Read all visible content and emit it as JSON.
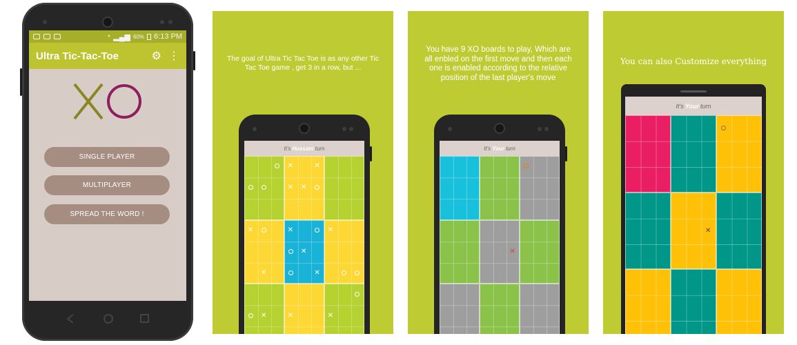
{
  "app": {
    "status_time": "6:13 PM",
    "battery": "60%",
    "title": "Ultra Tic-Tac-Toe",
    "logo_text": "XO",
    "buttons": {
      "single": "SINGLE PLAYER",
      "multi": "MULTIPLAYER",
      "spread": "SPREAD THE WORD !"
    },
    "colors": {
      "accent": "#bdc42f",
      "statusbar": "#a6ae2a",
      "button": "#a58d82",
      "background": "#d8ccc6"
    },
    "icons": [
      "gear-icon",
      "overflow-menu-icon",
      "back-nav-icon",
      "home-nav-icon",
      "recents-nav-icon"
    ]
  },
  "panel2": {
    "caption": "The goal of Ultra Tic Tac Toe is as any other Tic Tac Toe game , get 3 in a row, but ...",
    "turn_prefix": "It's",
    "turn_player": "Hussam",
    "turn_suffix": "turn"
  },
  "panel3": {
    "caption": "You have 9 XO boards to play, Which are all enbled on the first move and then each one is enabled according to the relative position of the last player's move",
    "turn_prefix": "It's",
    "turn_player": "Your",
    "turn_suffix": "turn"
  },
  "panel4": {
    "caption": "You can also Customize everything",
    "turn_prefix": "It's",
    "turn_player": "Your",
    "turn_suffix": "turn"
  },
  "board_colors": {
    "panel2": [
      "#b5d230",
      "#fdd835",
      "#b5d230",
      "#fdd835",
      "#1ab3d8",
      "#fdd835",
      "#b5d230",
      "#fdd835",
      "#b5d230"
    ],
    "panel3": [
      "#19c0dc",
      "#8bc34a",
      "#9e9e9e",
      "#8bc34a",
      "#9e9e9e",
      "#8bc34a",
      "#9e9e9e",
      "#8bc34a",
      "#9e9e9e"
    ],
    "panel4": [
      "#e91e63",
      "#009688",
      "#ffc107",
      "#009688",
      "#ffc107",
      "#009688",
      "#ffc107",
      "#009688",
      "#ffc107"
    ]
  }
}
